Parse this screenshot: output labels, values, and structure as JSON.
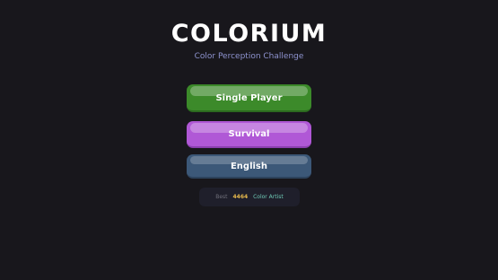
{
  "app": {
    "title": "COLORIUM",
    "subtitle": "Color Perception Challenge"
  },
  "menu": {
    "single_player": "Single Player",
    "survival": "Survival",
    "language": "English"
  },
  "best": {
    "label": "Best",
    "score": "4464",
    "rank": "Color Artist"
  },
  "colors": {
    "background": "#18171c",
    "single_player": "#3c8a2a",
    "survival": "#b058d6",
    "language": "#3c5878",
    "score": "#e6b84c",
    "rank": "#6ec9b5"
  }
}
